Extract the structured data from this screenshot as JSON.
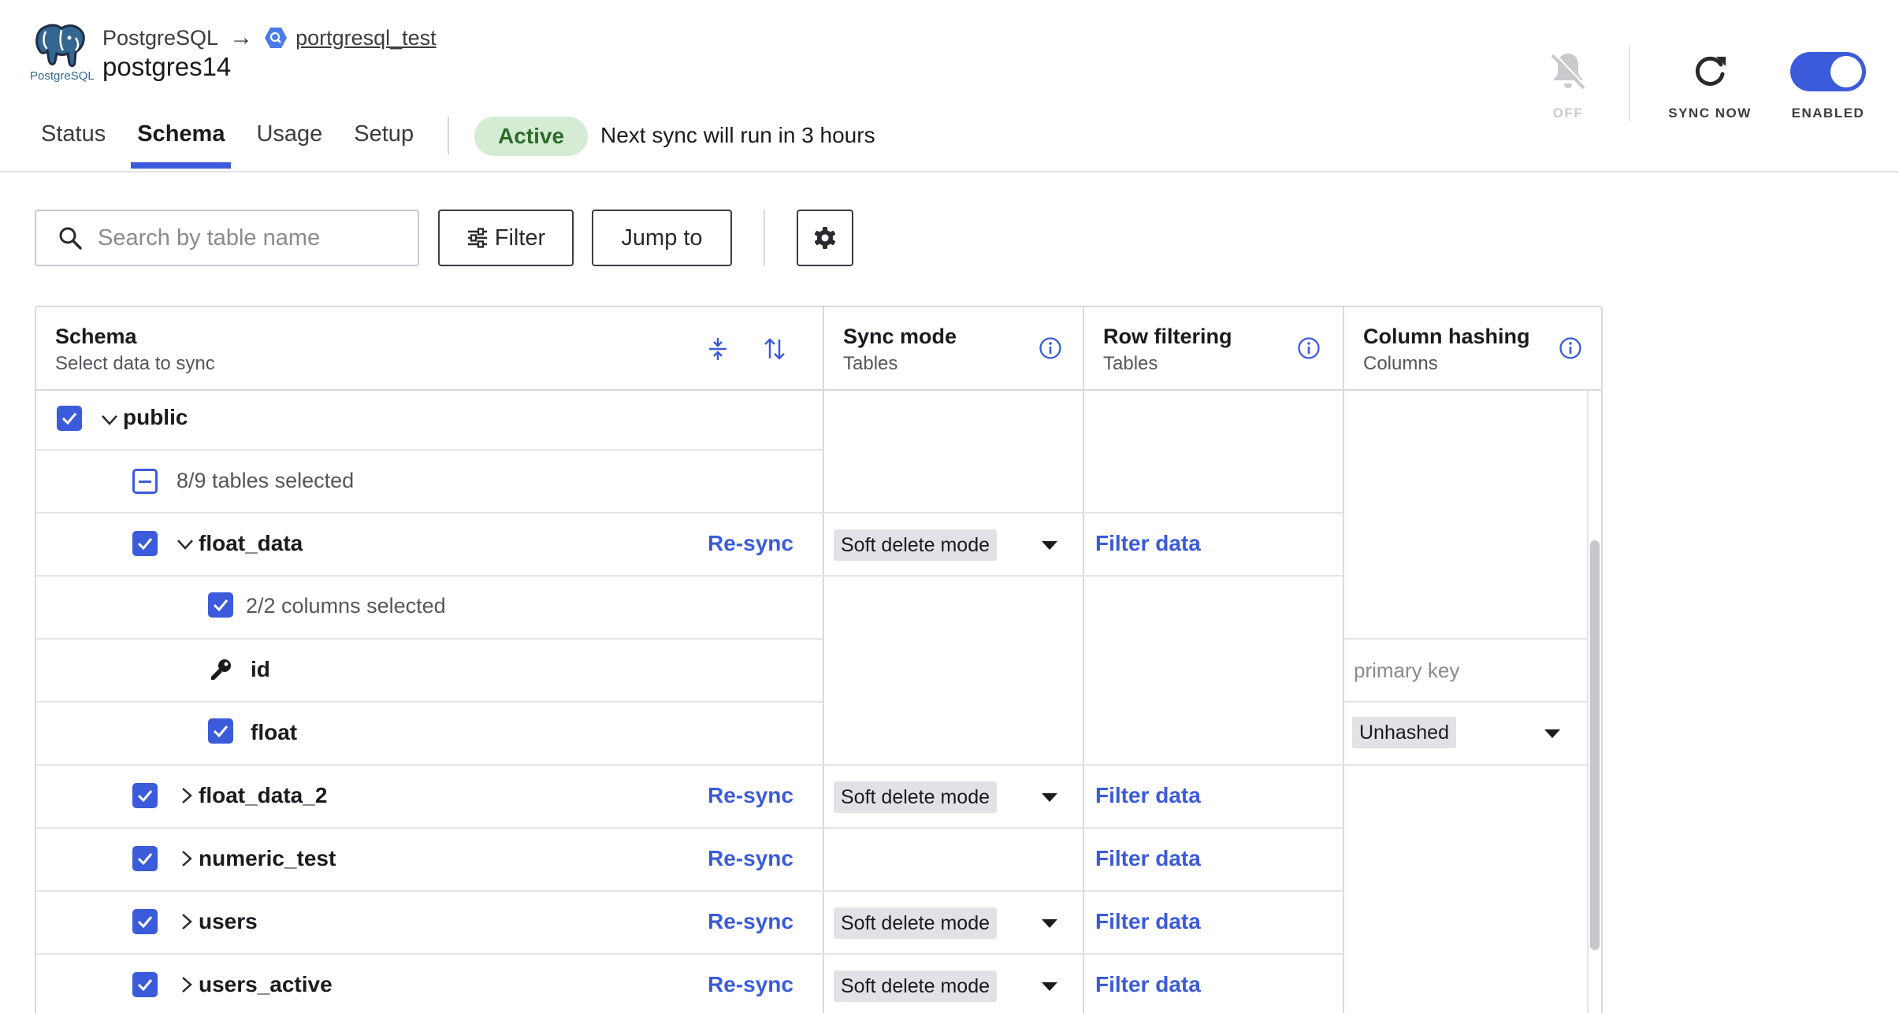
{
  "header": {
    "source_logo_text": "PostgreSQL",
    "breadcrumb_source": "PostgreSQL",
    "breadcrumb_destination": "portgresql_test",
    "connection_name": "postgres14"
  },
  "tabs": [
    {
      "label": "Status"
    },
    {
      "label": "Schema",
      "active": true
    },
    {
      "label": "Usage"
    },
    {
      "label": "Setup"
    }
  ],
  "status": {
    "badge": "Active",
    "next_sync": "Next sync will run in 3 hours"
  },
  "controls": {
    "notifications_label": "OFF",
    "sync_now_label": "SYNC NOW",
    "enabled_label": "ENABLED"
  },
  "toolbar": {
    "search_placeholder": "Search by table name",
    "filter_label": "Filter",
    "jump_label": "Jump to"
  },
  "columns": {
    "schema_title": "Schema",
    "schema_sub": "Select data to sync",
    "sync_title": "Sync mode",
    "sync_sub": "Tables",
    "rowfilter_title": "Row filtering",
    "rowfilter_sub": "Tables",
    "hash_title": "Column hashing",
    "hash_sub": "Columns"
  },
  "schema": {
    "name": "public",
    "selection_note": "8/9 tables selected"
  },
  "tables": [
    {
      "name": "float_data",
      "resync": "Re-sync",
      "sync_mode": "Soft delete mode",
      "filter": "Filter data",
      "expanded": true,
      "columns_note": "2/2 columns selected",
      "columns": [
        {
          "name": "id",
          "hashing": "primary key"
        },
        {
          "name": "float",
          "hashing": "Unhashed"
        }
      ]
    },
    {
      "name": "float_data_2",
      "resync": "Re-sync",
      "sync_mode": "Soft delete mode",
      "filter": "Filter data"
    },
    {
      "name": "numeric_test",
      "resync": "Re-sync",
      "sync_mode": "",
      "filter": "Filter data"
    },
    {
      "name": "users",
      "resync": "Re-sync",
      "sync_mode": "Soft delete mode",
      "filter": "Filter data"
    },
    {
      "name": "users_active",
      "resync": "Re-sync",
      "sync_mode": "Soft delete mode",
      "filter": "Filter data"
    }
  ],
  "colors": {
    "accent": "#3b5bdb",
    "active_badge_bg": "#d4ecd3",
    "active_badge_text": "#2d6a2b"
  }
}
